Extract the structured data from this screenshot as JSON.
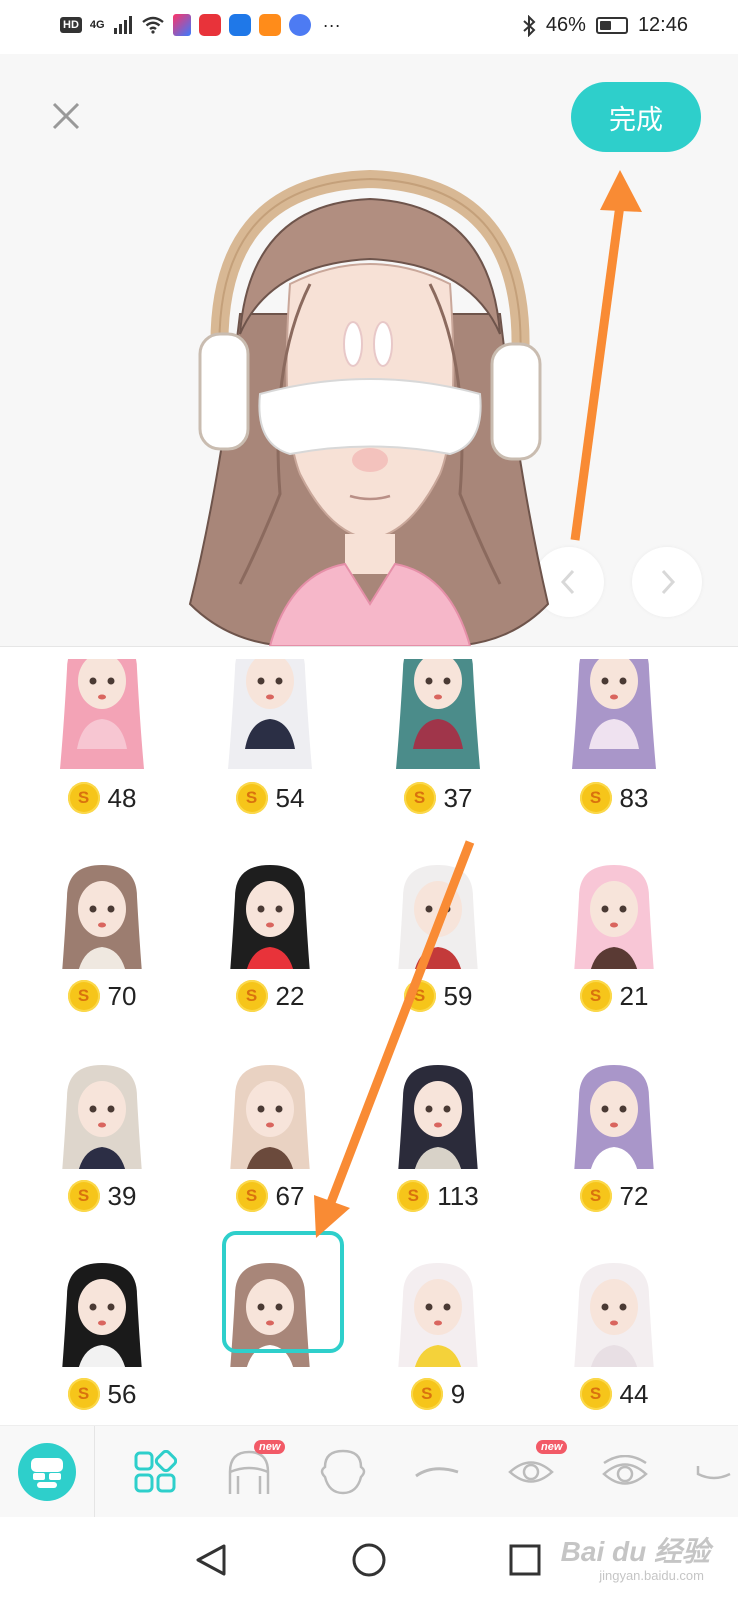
{
  "status_bar": {
    "hd": "HD",
    "network": "4G",
    "battery": "46%",
    "battery_level": 0.46,
    "time": "12:46",
    "more": "···",
    "app_icons": [
      "youku-icon",
      "huawei-store-icon",
      "bulb-icon",
      "video-icon",
      "music-icon"
    ]
  },
  "header": {
    "done_label": "完成"
  },
  "colors": {
    "accent": "#2ecfcb",
    "coin": "#f6c51a",
    "badge": "#f25a67",
    "annotation_arrow": "#f98b34"
  },
  "grid": {
    "items": [
      {
        "price": "48",
        "style": "pink-hair"
      },
      {
        "price": "54",
        "style": "white-hair-suit"
      },
      {
        "price": "37",
        "style": "teal-hair-glasses"
      },
      {
        "price": "83",
        "style": "purple-hair-kimono"
      },
      {
        "price": "70",
        "style": "brown-laurel"
      },
      {
        "price": "22",
        "style": "mouse-ears-heart-glasses"
      },
      {
        "price": "59",
        "style": "devil-horns"
      },
      {
        "price": "21",
        "style": "pink-earmuffs"
      },
      {
        "price": "39",
        "style": "beige-hair-uniform"
      },
      {
        "price": "67",
        "style": "beret"
      },
      {
        "price": "113",
        "style": "veil-hat"
      },
      {
        "price": "72",
        "style": "fox-mask"
      },
      {
        "price": "56",
        "style": "black-wavy-hair"
      },
      {
        "price": "",
        "style": "headphones-eye-mask",
        "selected": true
      },
      {
        "price": "9",
        "style": "flower-crown"
      },
      {
        "price": "44",
        "style": "white-long-hair"
      }
    ]
  },
  "tabs": {
    "items": [
      {
        "name": "avatar-tab",
        "badge": ""
      },
      {
        "name": "templates-tab",
        "badge": ""
      },
      {
        "name": "hair-tab",
        "badge": "new"
      },
      {
        "name": "face-shape-tab",
        "badge": ""
      },
      {
        "name": "eyebrow-tab",
        "badge": ""
      },
      {
        "name": "eyes-tab",
        "badge": "new"
      },
      {
        "name": "eye-detail-tab",
        "badge": ""
      }
    ]
  },
  "watermark": {
    "main": "Bai du 经验",
    "sub": "jingyan.baidu.com"
  }
}
